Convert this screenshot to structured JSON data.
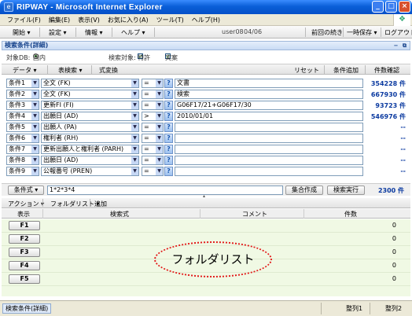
{
  "window": {
    "title": "RIPWAY - Microsoft Internet Explorer"
  },
  "menu": [
    "ファイル(F)",
    "編集(E)",
    "表示(V)",
    "お気に入り(A)",
    "ツール(T)",
    "ヘルプ(H)"
  ],
  "app_toolbar": {
    "start": "開始",
    "settings": "設定",
    "info": "情報",
    "help": "ヘルプ",
    "user": "user08",
    "date": "04/06",
    "continue": "前回の続き",
    "temp_save": "一時保存",
    "logout": "ログアウト"
  },
  "panel": {
    "title": "検索条件(詳細)"
  },
  "target": {
    "label": "対象DB:",
    "db": "国内",
    "search_target_label": "検索対象:",
    "patent": "特許",
    "utility": "実案"
  },
  "cond_toolbar": {
    "data": "データ",
    "table_search": "表検索",
    "formula_conv": "式変換",
    "reset": "リセット",
    "add_condition": "条件追加",
    "count_check": "件数確認"
  },
  "conditions": [
    {
      "label": "条件1",
      "field": "全文 (FK)",
      "op": "=",
      "value": "文書",
      "count": "354228 件"
    },
    {
      "label": "条件2",
      "field": "全文 (FK)",
      "op": "=",
      "value": "検索",
      "count": "667930 件"
    },
    {
      "label": "条件3",
      "field": "更新FI (FI)",
      "op": "=",
      "value": "G06F17/21+G06F17/30",
      "count": "93723 件"
    },
    {
      "label": "条件4",
      "field": "出願日 (AD)",
      "op": ">",
      "value": "2010/01/01",
      "count": "546976 件"
    },
    {
      "label": "条件5",
      "field": "出願人 (PA)",
      "op": "=",
      "value": "",
      "count": "--"
    },
    {
      "label": "条件6",
      "field": "権利者 (RH)",
      "op": "=",
      "value": "",
      "count": "--"
    },
    {
      "label": "条件7",
      "field": "更新出願人と権利者 (PARH)",
      "op": "=",
      "value": "",
      "count": "--"
    },
    {
      "label": "条件8",
      "field": "出願日 (AD)",
      "op": "=",
      "value": "",
      "count": "--"
    },
    {
      "label": "条件9",
      "field": "公報番号 (PREN)",
      "op": "=",
      "value": "",
      "count": "--"
    }
  ],
  "formula": {
    "label": "条件式",
    "value": "1*2*3*4",
    "set_create": "集合作成",
    "execute": "検索実行",
    "total": "2300 件"
  },
  "folder_toolbar": {
    "action": "アクション",
    "folder_list": "フォルダリスト",
    "add": "追加"
  },
  "folder_table": {
    "headers": {
      "display": "表示",
      "formula": "検索式",
      "comment": "コメント",
      "count": "件数"
    },
    "rows": [
      {
        "label": "F1",
        "count": "0"
      },
      {
        "label": "F2",
        "count": "0"
      },
      {
        "label": "F3",
        "count": "0"
      },
      {
        "label": "F4",
        "count": "0"
      },
      {
        "label": "F5",
        "count": "0"
      }
    ]
  },
  "annotation": "フォルダリスト",
  "statusbar": {
    "tab": "検索条件(詳細)",
    "sort1": "整列1",
    "sort2": "整列2"
  }
}
